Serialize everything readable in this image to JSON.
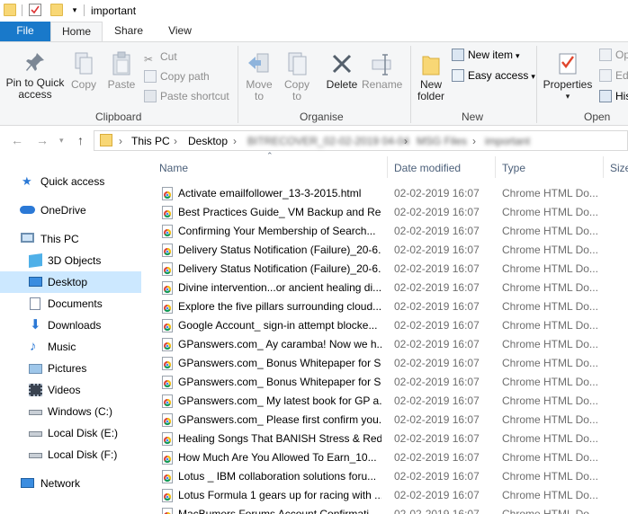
{
  "window": {
    "title": "important"
  },
  "tabs": [
    {
      "label": "File"
    },
    {
      "label": "Home"
    },
    {
      "label": "Share"
    },
    {
      "label": "View"
    }
  ],
  "ribbon": {
    "clipboard": {
      "pin_label_1": "Pin to Quick",
      "pin_label_2": "access",
      "copy_label": "Copy",
      "paste_label": "Paste",
      "cut_label": "Cut",
      "copy_path_label": "Copy path",
      "paste_shortcut_label": "Paste shortcut",
      "group_label": "Clipboard"
    },
    "organise": {
      "move_to_1": "Move",
      "move_to_2": "to",
      "copy_to_1": "Copy",
      "copy_to_2": "to",
      "delete_label": "Delete",
      "rename_label": "Rename",
      "group_label": "Organise"
    },
    "new": {
      "new_folder_1": "New",
      "new_folder_2": "folder",
      "new_item_label": "New item",
      "easy_access_label": "Easy access",
      "group_label": "New"
    },
    "open": {
      "properties_label": "Properties",
      "open_label": "Op",
      "edit_label": "Edi",
      "history_label": "His",
      "group_label": "Open"
    }
  },
  "address": {
    "crumbs": [
      "This PC",
      "Desktop",
      "BITRECOVER_02-02-2019 04-04",
      "MSG Files",
      "important"
    ]
  },
  "nav": {
    "items": [
      {
        "label": "Quick access",
        "icon": "star-icon"
      },
      {
        "label": "OneDrive",
        "icon": "cloud-icon"
      },
      {
        "label": "This PC",
        "icon": "computer-icon"
      },
      {
        "label": "3D Objects",
        "icon": "cube-icon"
      },
      {
        "label": "Desktop",
        "icon": "desktop-icon",
        "selected": true
      },
      {
        "label": "Documents",
        "icon": "documents-icon"
      },
      {
        "label": "Downloads",
        "icon": "download-icon"
      },
      {
        "label": "Music",
        "icon": "music-icon"
      },
      {
        "label": "Pictures",
        "icon": "pictures-icon"
      },
      {
        "label": "Videos",
        "icon": "videos-icon"
      },
      {
        "label": "Windows (C:)",
        "icon": "drive-icon"
      },
      {
        "label": "Local Disk (E:)",
        "icon": "drive-icon"
      },
      {
        "label": "Local Disk (F:)",
        "icon": "drive-icon"
      },
      {
        "label": "Network",
        "icon": "network-icon"
      }
    ]
  },
  "list": {
    "columns": {
      "name": "Name",
      "date": "Date modified",
      "type": "Type",
      "size": "Size"
    },
    "rows": [
      {
        "name": "Activate emailfollower_13-3-2015.html",
        "date": "02-02-2019 16:07",
        "type": "Chrome HTML Do..."
      },
      {
        "name": "Best Practices Guide_ VM Backup and Re...",
        "date": "02-02-2019 16:07",
        "type": "Chrome HTML Do..."
      },
      {
        "name": "Confirming Your Membership of Search...",
        "date": "02-02-2019 16:07",
        "type": "Chrome HTML Do..."
      },
      {
        "name": "Delivery Status Notification (Failure)_20-6...",
        "date": "02-02-2019 16:07",
        "type": "Chrome HTML Do..."
      },
      {
        "name": "Delivery Status Notification (Failure)_20-6...",
        "date": "02-02-2019 16:07",
        "type": "Chrome HTML Do..."
      },
      {
        "name": "Divine intervention...or ancient healing di...",
        "date": "02-02-2019 16:07",
        "type": "Chrome HTML Do..."
      },
      {
        "name": "Explore the five pillars surrounding cloud...",
        "date": "02-02-2019 16:07",
        "type": "Chrome HTML Do..."
      },
      {
        "name": "Google Account_ sign-in attempt blocke...",
        "date": "02-02-2019 16:07",
        "type": "Chrome HTML Do..."
      },
      {
        "name": "GPanswers.com_ Ay caramba! Now we h...",
        "date": "02-02-2019 16:07",
        "type": "Chrome HTML Do..."
      },
      {
        "name": "GPanswers.com_ Bonus Whitepaper for S...",
        "date": "02-02-2019 16:07",
        "type": "Chrome HTML Do..."
      },
      {
        "name": "GPanswers.com_ Bonus Whitepaper for S...",
        "date": "02-02-2019 16:07",
        "type": "Chrome HTML Do..."
      },
      {
        "name": "GPanswers.com_ My latest book for GP a...",
        "date": "02-02-2019 16:07",
        "type": "Chrome HTML Do..."
      },
      {
        "name": "GPanswers.com_ Please first confirm you...",
        "date": "02-02-2019 16:07",
        "type": "Chrome HTML Do..."
      },
      {
        "name": "Healing Songs That BANISH Stress & Red...",
        "date": "02-02-2019 16:07",
        "type": "Chrome HTML Do..."
      },
      {
        "name": "How Much Are You Allowed To Earn_10...",
        "date": "02-02-2019 16:07",
        "type": "Chrome HTML Do..."
      },
      {
        "name": "Lotus _ IBM collaboration solutions foru...",
        "date": "02-02-2019 16:07",
        "type": "Chrome HTML Do..."
      },
      {
        "name": "Lotus Formula 1 gears up for racing with ...",
        "date": "02-02-2019 16:07",
        "type": "Chrome HTML Do..."
      },
      {
        "name": "MacBumers Forums Account Confirmati...",
        "date": "02-02-2019 16:07",
        "type": "Chrome HTML Do..."
      }
    ]
  },
  "colors": {
    "file_tab": "#1979ca",
    "selection": "#cce8ff",
    "folder": "#f8d775",
    "header_text": "#4c607a"
  }
}
